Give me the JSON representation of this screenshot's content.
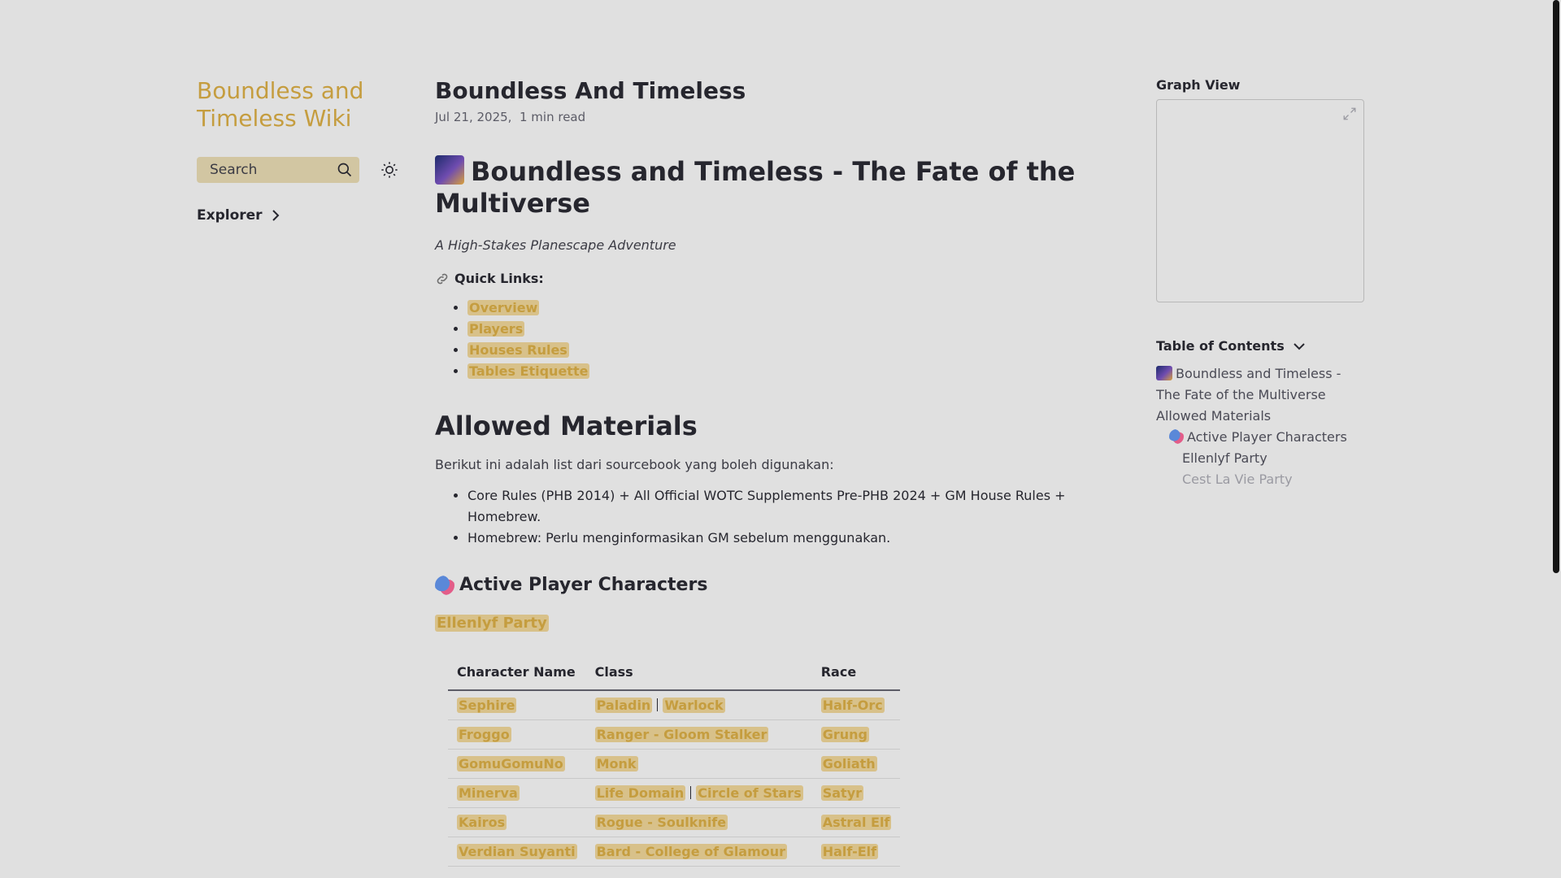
{
  "sidebar": {
    "site_title": "Boundless and Timeless Wiki",
    "search_placeholder": "Search",
    "explorer_label": "Explorer"
  },
  "article": {
    "title": "Boundless And Timeless",
    "date": "Jul 21, 2025",
    "read_time": "1 min read",
    "heading1": "Boundless and Timeless - The Fate of the Multiverse",
    "subtitle": "A High-Stakes Planescape Adventure",
    "quick_links_label": "Quick Links:",
    "quick_links": [
      "Overview",
      "Players",
      "Houses Rules",
      "Tables Etiquette"
    ],
    "allowed_heading": "Allowed Materials",
    "allowed_intro": "Berikut ini adalah list dari sourcebook yang boleh digunakan:",
    "allowed_items": [
      "Core Rules (PHB 2014) + All Official WOTC Supplements Pre-PHB 2024 + GM House Rules + Homebrew.",
      "Homebrew: Perlu menginformasikan GM sebelum menggunakan."
    ],
    "active_heading": "Active Player Characters",
    "party_link": "Ellenlyf Party",
    "table": {
      "headers": [
        "Character Name",
        "Class",
        "Race"
      ],
      "rows": [
        {
          "name": "Sephire",
          "class": [
            "Paladin",
            "Warlock"
          ],
          "race": "Half-Orc"
        },
        {
          "name": "Froggo",
          "class": [
            "Ranger - Gloom Stalker"
          ],
          "race": "Grung"
        },
        {
          "name": "GomuGomuNo",
          "class": [
            "Monk"
          ],
          "race": "Goliath"
        },
        {
          "name": "Minerva",
          "class": [
            "Life Domain",
            "Circle of Stars"
          ],
          "race": "Satyr"
        },
        {
          "name": "Kairos",
          "class": [
            "Rogue - Soulknife"
          ],
          "race": "Astral Elf"
        },
        {
          "name": "Verdian Suyanti",
          "class": [
            "Bard - College of Glamour"
          ],
          "race": "Half-Elf"
        }
      ]
    }
  },
  "right": {
    "graph_title": "Graph View",
    "toc_title": "Table of Contents",
    "toc": [
      {
        "text": "Boundless and Timeless - The Fate of the Multiverse",
        "level": 0,
        "icon": "galaxy"
      },
      {
        "text": "Allowed Materials",
        "level": 0
      },
      {
        "text": "Active Player Characters",
        "level": 1,
        "icon": "masks"
      },
      {
        "text": "Ellenlyf Party",
        "level": 2
      },
      {
        "text": "Cest La Vie Party",
        "level": 2,
        "faded": true
      }
    ]
  },
  "colors": {
    "accent": "#c59d3f",
    "link_bg": "#d8c18a",
    "background": "#e0e0e0",
    "text": "#26262e"
  }
}
